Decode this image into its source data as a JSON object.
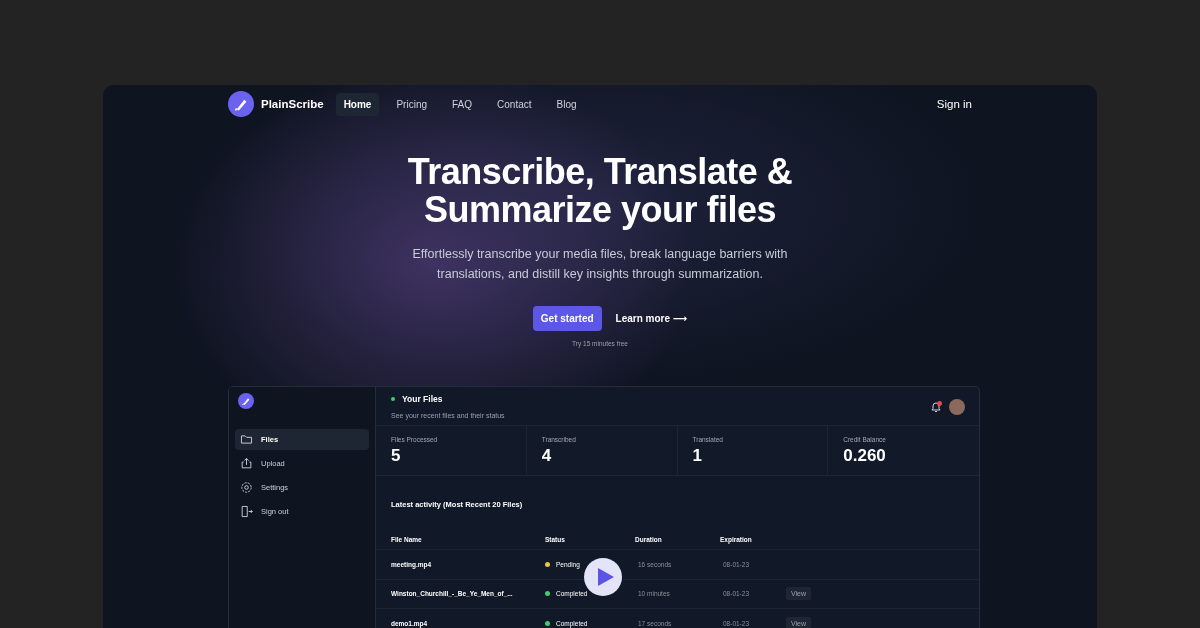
{
  "nav": {
    "brand": "PlainScribe",
    "links": [
      {
        "label": "Home",
        "selected": true
      },
      {
        "label": "Pricing",
        "selected": false
      },
      {
        "label": "FAQ",
        "selected": false
      },
      {
        "label": "Contact",
        "selected": false
      },
      {
        "label": "Blog",
        "selected": false
      }
    ],
    "sign_in": "Sign in"
  },
  "hero": {
    "title_lines": [
      "Transcribe, Translate &",
      "Summarize your files"
    ],
    "subtitle": "Effortlessly transcribe your media files, break language barriers with translations, and distill key insights through summarization.",
    "primary_button": "Get started",
    "secondary_link": "Learn more ⟶",
    "note": "Try 15 minutes free"
  },
  "dashboard": {
    "sidebar": {
      "items": [
        {
          "label": "Files",
          "selected": true
        },
        {
          "label": "Upload",
          "selected": false
        },
        {
          "label": "Settings",
          "selected": false
        },
        {
          "label": "Sign out",
          "selected": false
        }
      ]
    },
    "header": {
      "title": "Your Files",
      "subtitle": "See your recent files and their status"
    },
    "stats": [
      {
        "label": "Files Processed",
        "value": "5"
      },
      {
        "label": "Transcribed",
        "value": "4"
      },
      {
        "label": "Translated",
        "value": "1"
      },
      {
        "label": "Credit Balance",
        "value": "0.260"
      }
    ],
    "table": {
      "title": "Latest activity (Most Recent 20 Files)",
      "columns": [
        "File Name",
        "Status",
        "Duration",
        "Expiration"
      ],
      "rows": [
        {
          "file": "meeting.mp4",
          "status": "Pending",
          "color": "#e8c547",
          "duration": "16 seconds",
          "expiration": "08-01-23",
          "action": null
        },
        {
          "file": "Winston_Churchill_-_Be_Ye_Men_of_...",
          "status": "Completed",
          "color": "#3ccf6e",
          "duration": "10 minutes",
          "expiration": "08-01-23",
          "action": "View"
        },
        {
          "file": "demo1.mp4",
          "status": "Completed",
          "color": "#3ccf6e",
          "duration": "17 seconds",
          "expiration": "08-01-23",
          "action": "View"
        }
      ]
    }
  }
}
